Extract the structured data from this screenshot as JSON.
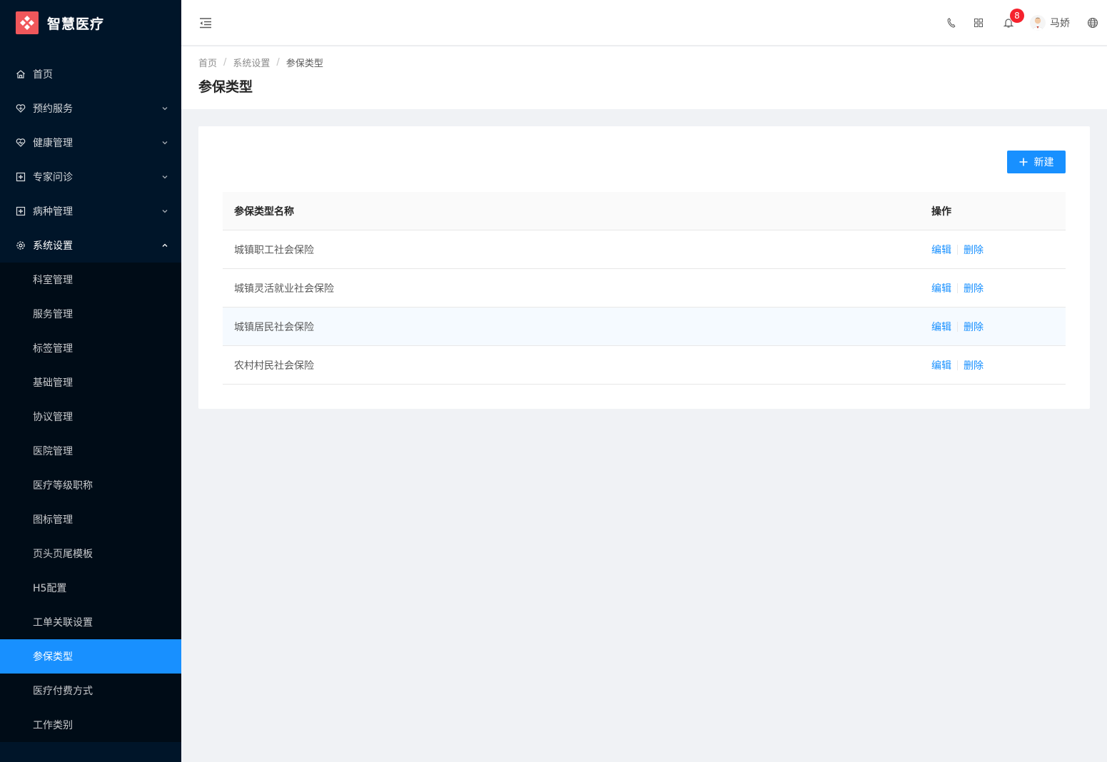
{
  "app": {
    "name": "智慧医疗"
  },
  "sidebar": {
    "items": [
      {
        "label": "首页",
        "icon": "home-icon",
        "has_arrow": false
      },
      {
        "label": "预约服务",
        "icon": "heart-appointment-icon",
        "has_arrow": true
      },
      {
        "label": "健康管理",
        "icon": "heart-pulse-icon",
        "has_arrow": true
      },
      {
        "label": "专家问诊",
        "icon": "medical-box-icon",
        "has_arrow": true
      },
      {
        "label": "病种管理",
        "icon": "medical-box-icon",
        "has_arrow": true
      },
      {
        "label": "系统设置",
        "icon": "gear-icon",
        "has_arrow": true,
        "open": true
      }
    ],
    "submenu": [
      {
        "label": "科室管理"
      },
      {
        "label": "服务管理"
      },
      {
        "label": "标签管理"
      },
      {
        "label": "基础管理"
      },
      {
        "label": "协议管理"
      },
      {
        "label": "医院管理"
      },
      {
        "label": "医疗等级职称"
      },
      {
        "label": "图标管理"
      },
      {
        "label": "页头页尾模板"
      },
      {
        "label": "H5配置"
      },
      {
        "label": "工单关联设置"
      },
      {
        "label": "参保类型",
        "active": true
      },
      {
        "label": "医疗付费方式"
      },
      {
        "label": "工作类别"
      }
    ]
  },
  "header": {
    "notification_count": "8",
    "user_name": "马娇"
  },
  "breadcrumb": {
    "items": [
      "首页",
      "系统设置",
      "参保类型"
    ]
  },
  "page": {
    "title": "参保类型",
    "new_button": "新建"
  },
  "table": {
    "columns": [
      "参保类型名称",
      "操作"
    ],
    "rows": [
      {
        "name": "城镇职工社会保险",
        "edit": "编辑",
        "delete": "删除"
      },
      {
        "name": "城镇灵活就业社会保险",
        "edit": "编辑",
        "delete": "删除"
      },
      {
        "name": "城镇居民社会保险",
        "edit": "编辑",
        "delete": "删除"
      },
      {
        "name": "农村村民社会保险",
        "edit": "编辑",
        "delete": "删除"
      }
    ]
  },
  "colors": {
    "sidebar_bg": "#001529",
    "submenu_bg": "#000c17",
    "primary": "#1890ff",
    "logo": "#f0575b",
    "badge": "#f5222d"
  }
}
